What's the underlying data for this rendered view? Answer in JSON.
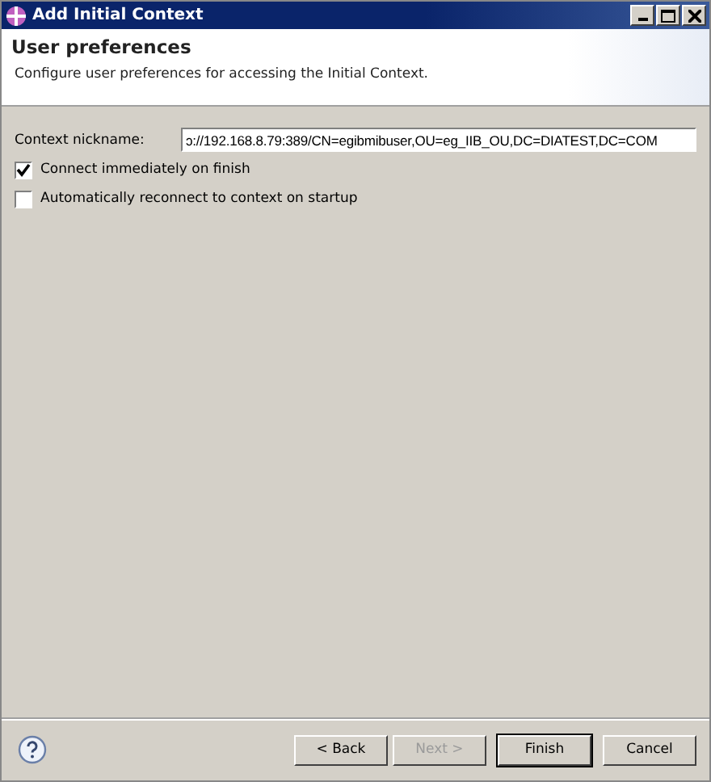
{
  "window": {
    "title": "Add Initial Context"
  },
  "header": {
    "title": "User preferences",
    "description": "Configure user preferences for accessing the Initial Context."
  },
  "form": {
    "label": "Context nickname:",
    "value": "ɔ://192.168.8.79:389/CN=egibmibuser,OU=eg_IIB_OU,DC=DIATEST,DC=COM"
  },
  "options": [
    {
      "label": "Connect immediately on finish",
      "checked": true
    },
    {
      "label": "Automatically reconnect to context on startup",
      "checked": false
    }
  ],
  "buttons": [
    {
      "label": "< Back",
      "disabled": false,
      "default": false
    },
    {
      "label": "Next >",
      "disabled": true,
      "default": false
    },
    {
      "label": "Finish",
      "disabled": false,
      "default": true
    },
    {
      "label": "Cancel",
      "disabled": false,
      "default": false
    }
  ]
}
